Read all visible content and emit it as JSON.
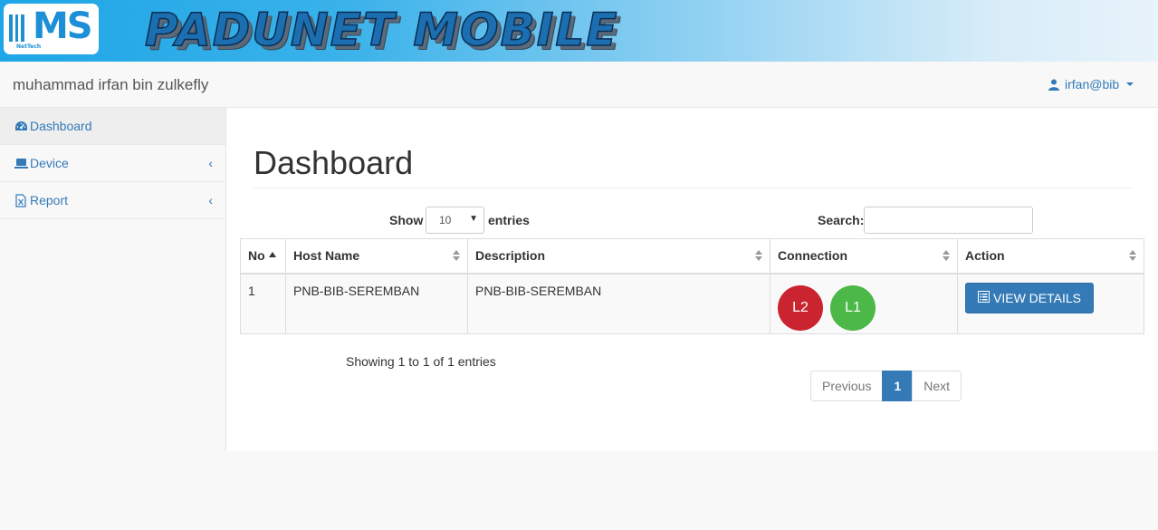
{
  "banner": {
    "logo_text": "MS",
    "logo_sub": "NetTech",
    "title": "PADUNET MOBILE"
  },
  "navbar": {
    "user_fullname": "muhammad irfan bin zulkefly",
    "username": "irfan@bib"
  },
  "sidebar": {
    "items": [
      {
        "label": "Dashboard",
        "icon": "dashboard-icon",
        "active": true
      },
      {
        "label": "Device",
        "icon": "device-icon",
        "chevron": "‹"
      },
      {
        "label": "Report",
        "icon": "report-icon",
        "chevron": "‹"
      }
    ]
  },
  "main": {
    "page_title": "Dashboard",
    "show_label": "Show",
    "entries_value": "10",
    "entries_label": "entries",
    "search_label": "Search:",
    "search_value": "",
    "columns": [
      "No",
      "Host Name",
      "Description",
      "Connection",
      "Action"
    ],
    "rows": [
      {
        "no": "1",
        "host": "PNB-BIB-SEREMBAN",
        "description": "PNB-BIB-SEREMBAN",
        "connections": [
          "L2",
          "L1"
        ],
        "action": "VIEW DETAILS"
      }
    ],
    "showing_text": "Showing 1 to 1 of 1 entries",
    "pagination": {
      "prev": "Previous",
      "current": "1",
      "next": "Next"
    }
  },
  "colors": {
    "primary": "#337ab7",
    "link_down": "#c9242f",
    "link_up": "#4cb848"
  }
}
